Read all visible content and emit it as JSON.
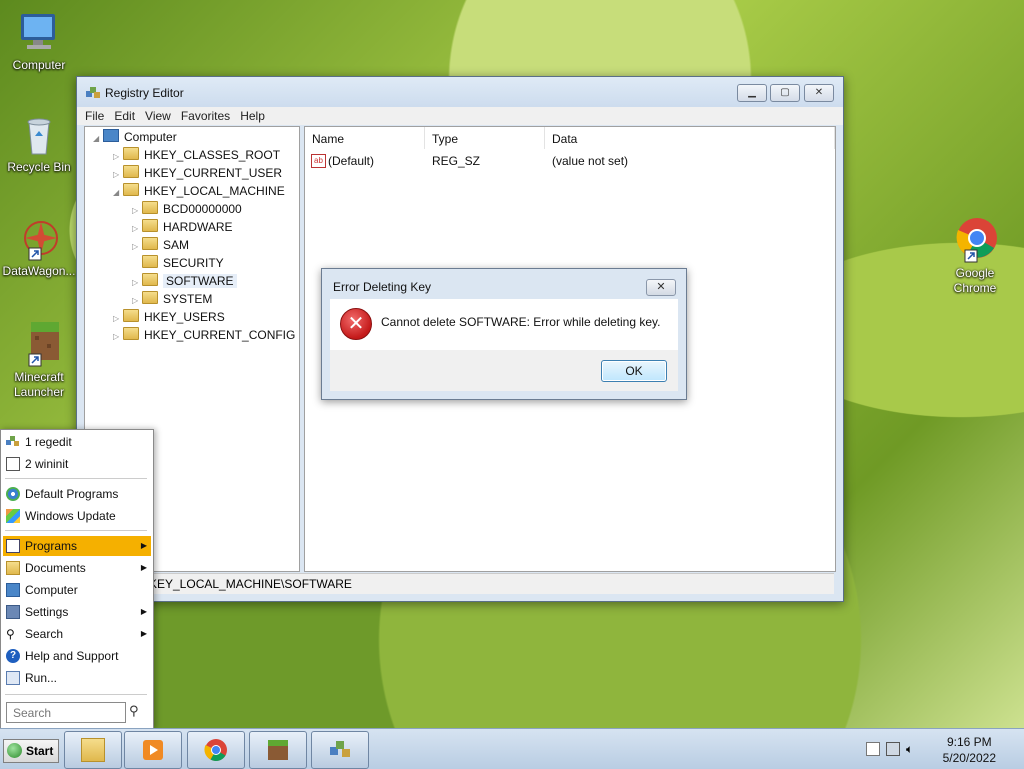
{
  "desktop": {
    "icons": [
      {
        "label": "Computer"
      },
      {
        "label": "Recycle Bin"
      },
      {
        "label": "DataWagon..."
      },
      {
        "label": "Minecraft Launcher"
      },
      {
        "label": "Google Chrome"
      }
    ]
  },
  "regedit": {
    "title": "Registry Editor",
    "menu": [
      "File",
      "Edit",
      "View",
      "Favorites",
      "Help"
    ],
    "tree": {
      "root": "Computer",
      "hives": [
        "HKEY_CLASSES_ROOT",
        "HKEY_CURRENT_USER",
        "HKEY_LOCAL_MACHINE",
        "HKEY_USERS",
        "HKEY_CURRENT_CONFIG"
      ],
      "hklm_children": [
        "BCD00000000",
        "HARDWARE",
        "SAM",
        "SECURITY",
        "SOFTWARE",
        "SYSTEM"
      ]
    },
    "columns": [
      "Name",
      "Type",
      "Data"
    ],
    "rows": [
      {
        "name": "(Default)",
        "type": "REG_SZ",
        "data": "(value not set)"
      }
    ],
    "status": "KEY_LOCAL_MACHINE\\SOFTWARE"
  },
  "dialog": {
    "title": "Error Deleting Key",
    "message": "Cannot delete SOFTWARE:  Error while deleting key.",
    "ok": "OK"
  },
  "start_menu": {
    "recent": [
      "1 regedit",
      "2 wininit"
    ],
    "items": [
      "Default Programs",
      "Windows Update",
      "Programs",
      "Documents",
      "Computer",
      "Settings",
      "Search",
      "Help and Support",
      "Run..."
    ],
    "search_placeholder": "Search"
  },
  "taskbar": {
    "start_label": "Start",
    "time": "9:16 PM",
    "date": "5/20/2022"
  },
  "colors": {
    "highlight": "#f5b000",
    "dialog_bg": "#dbe6f2"
  }
}
